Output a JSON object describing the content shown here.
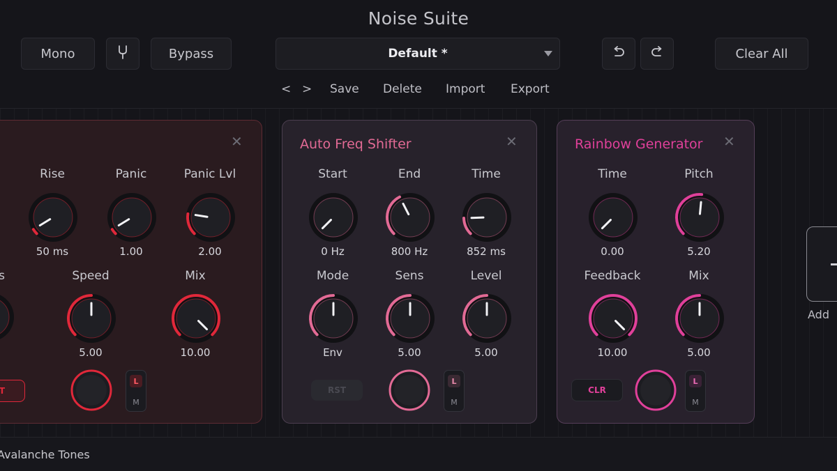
{
  "app": {
    "title": "Noise Suite"
  },
  "toolbar": {
    "mono": "Mono",
    "fork_icon": "tuning-fork-icon",
    "bypass": "Bypass",
    "preset": "Default *",
    "undo_icon": "undo-icon",
    "redo_icon": "redo-icon",
    "clear_all": "Clear All"
  },
  "preset_links": {
    "prev": "<",
    "next": ">",
    "save": "Save",
    "delete": "Delete",
    "import": "Import",
    "export": "Export"
  },
  "colors": {
    "red_accent": "#e0283a",
    "pink_accent": "#e26a95",
    "rainbow_accent": "#e0409a"
  },
  "panels": [
    {
      "title": "",
      "top_knobs": [
        {
          "label": "Rise",
          "value": "50 ms",
          "level": 0.05
        },
        {
          "label": "Panic",
          "value": "1.00",
          "level": 0.05
        },
        {
          "label": "Panic Lvl",
          "value": "2.00",
          "level": 0.2
        }
      ],
      "bottom_knobs": [
        {
          "label": "s",
          "value": "",
          "level": 0.5
        },
        {
          "label": "Speed",
          "value": "5.00",
          "level": 0.5
        },
        {
          "label": "Mix",
          "value": "10.00",
          "level": 1.0
        }
      ],
      "reset_label": "T",
      "lm": {
        "l": "L",
        "m": "M"
      }
    },
    {
      "title": "Auto Freq Shifter",
      "top_knobs": [
        {
          "label": "Start",
          "value": "0 Hz",
          "level": 0.0
        },
        {
          "label": "End",
          "value": "800 Hz",
          "level": 0.4
        },
        {
          "label": "Time",
          "value": "852 ms",
          "level": 0.16
        }
      ],
      "bottom_knobs": [
        {
          "label": "Mode",
          "value": "Env",
          "level": 0.5
        },
        {
          "label": "Sens",
          "value": "5.00",
          "level": 0.5
        },
        {
          "label": "Level",
          "value": "5.00",
          "level": 0.5
        }
      ],
      "reset_label": "RST",
      "lm": {
        "l": "L",
        "m": "M"
      }
    },
    {
      "title": "Rainbow Generator",
      "top_knobs": [
        {
          "label": "Time",
          "value": "0.00",
          "level": 0.0
        },
        {
          "label": "Pitch",
          "value": "5.20",
          "level": 0.52
        }
      ],
      "bottom_knobs": [
        {
          "label": "Feedback",
          "value": "10.00",
          "level": 1.0
        },
        {
          "label": "Mix",
          "value": "5.00",
          "level": 0.5
        }
      ],
      "reset_label": "CLR",
      "lm": {
        "l": "L",
        "m": "M"
      }
    }
  ],
  "add": {
    "label": "Add",
    "icon": "plus-icon"
  },
  "status": {
    "text": "Avalanche Tones"
  }
}
